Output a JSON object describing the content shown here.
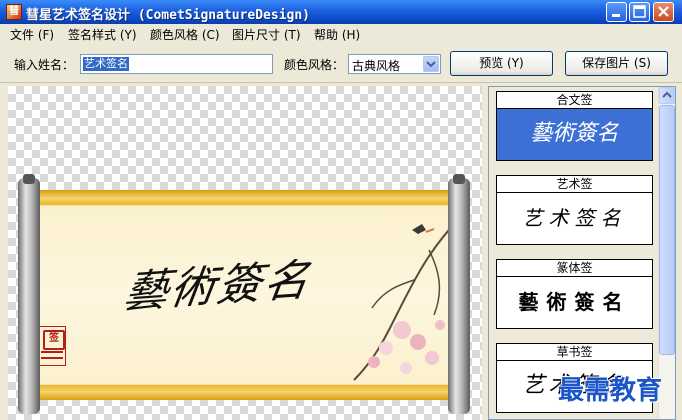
{
  "window": {
    "title": "彗星艺术签名设计 (CometSignatureDesign)",
    "icon_label": "彗"
  },
  "menu": [
    {
      "label": "文件 (F)"
    },
    {
      "label": "签名样式 (Y)"
    },
    {
      "label": "颜色风格 (C)"
    },
    {
      "label": "图片尺寸 (T)"
    },
    {
      "label": "帮助 (H)"
    }
  ],
  "toolbar": {
    "name_label": "输入姓名：",
    "name_value": "艺术签名",
    "color_label": "颜色风格：",
    "color_value": "古典风格",
    "preview_button": "预览 (Y)",
    "save_button": "保存图片 (S)"
  },
  "preview": {
    "signature": "藝術簽名",
    "seal_text": "签"
  },
  "styles": [
    {
      "name": "合文签",
      "sample": "藝術簽名",
      "selected": true
    },
    {
      "name": "艺术签",
      "sample": "艺术签名",
      "selected": false
    },
    {
      "name": "篆体签",
      "sample": "藝術簽名",
      "selected": false
    },
    {
      "name": "草书签",
      "sample": "艺术签名",
      "selected": false
    }
  ],
  "watermark": "最需教育",
  "colors": {
    "titlebar": "#0d4ac8",
    "selected_card": "#3c70d4",
    "seal": "#b3201a",
    "scroll_gold": "#e9b62c"
  },
  "icons": [
    "app-icon",
    "minimize-icon",
    "maximize-icon",
    "close-icon",
    "dropdown-arrow-icon",
    "scroll-up-icon"
  ]
}
